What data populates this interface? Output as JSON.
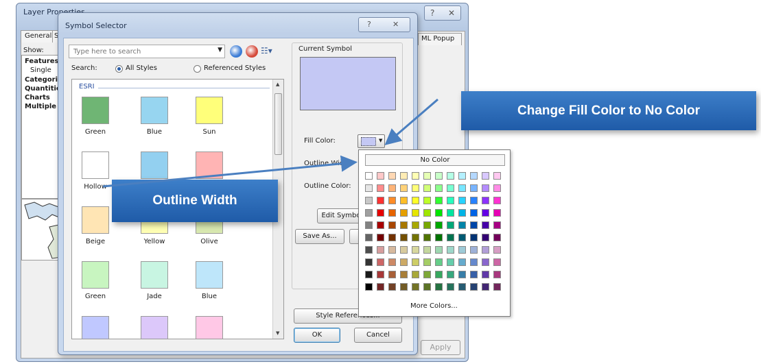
{
  "layer_properties": {
    "title": "Layer Properties",
    "tabs": [
      "General",
      "S"
    ],
    "right_tab": "ML Popup",
    "show_label": "Show:",
    "tree": [
      "Features",
      "Single",
      "Categori",
      "Quantitie",
      "Charts",
      "Multiple"
    ],
    "apply_label": "Apply"
  },
  "symbol_selector": {
    "title": "Symbol Selector",
    "search": {
      "placeholder": "Type here to search"
    },
    "search_label": "Search:",
    "radio_all": "All Styles",
    "radio_ref": "Referenced Styles",
    "group_label": "ESRI",
    "symbols": [
      {
        "label": "Green",
        "color": "#6fb574"
      },
      {
        "label": "Blue",
        "color": "#97d5f0"
      },
      {
        "label": "Sun",
        "color": "#ffff7a"
      },
      {
        "label": "Hollow",
        "color": "#ffffff"
      },
      {
        "label": "",
        "color": "#93d0f0"
      },
      {
        "label": "",
        "color": "#ffb4b4"
      },
      {
        "label": "Beige",
        "color": "#ffe5b4"
      },
      {
        "label": "Yellow",
        "color": "#ffffb4"
      },
      {
        "label": "Olive",
        "color": "#d8e8b0"
      },
      {
        "label": "Green",
        "color": "#c8f5c0"
      },
      {
        "label": "Jade",
        "color": "#c8f5e2"
      },
      {
        "label": "Blue",
        "color": "#bee6fa"
      },
      {
        "label": "",
        "color": "#c0c8ff"
      },
      {
        "label": "",
        "color": "#dcc8fa"
      },
      {
        "label": "",
        "color": "#ffc8e6"
      }
    ],
    "current_symbol_label": "Current Symbol",
    "current_fill": "#c4c8f4",
    "fill_color_label": "Fill Color:",
    "outline_width_label": "Outline Width:",
    "outline_color_label": "Outline Color:",
    "edit_symbol_label": "Edit Symbo",
    "save_as_label": "Save As...",
    "style_references_label": "Style References...",
    "ok_label": "OK",
    "cancel_label": "Cancel"
  },
  "palette": {
    "no_color_label": "No Color",
    "more_colors_label": "More Colors...",
    "columns": 12,
    "rows": [
      [
        "#ffffff",
        "#ffc8c8",
        "#ffd8b4",
        "#ffecb4",
        "#ffffb4",
        "#e6ffb4",
        "#c8ffc8",
        "#b4ffe6",
        "#b4f0ff",
        "#b4d8ff",
        "#d8c8ff",
        "#ffc8f0"
      ],
      [
        "#e6e6e6",
        "#ff8c8c",
        "#ffb478",
        "#ffd278",
        "#ffff78",
        "#d2ff78",
        "#8cff8c",
        "#78ffd2",
        "#78e6ff",
        "#78b4ff",
        "#b48cff",
        "#ff8ce6"
      ],
      [
        "#c8c8c8",
        "#ff3232",
        "#ff8c28",
        "#ffbe28",
        "#ffff28",
        "#beff28",
        "#32ff32",
        "#28ffbe",
        "#28d2ff",
        "#2882ff",
        "#8c32ff",
        "#ff32d2"
      ],
      [
        "#a0a0a0",
        "#e60000",
        "#e66400",
        "#e6a000",
        "#e6e600",
        "#a0e600",
        "#00e600",
        "#00e6a0",
        "#00b4e6",
        "#0064e6",
        "#6400e6",
        "#e600b4"
      ],
      [
        "#828282",
        "#a80000",
        "#a84600",
        "#a87800",
        "#a8a800",
        "#78a800",
        "#00a800",
        "#00a878",
        "#0084a8",
        "#0046a8",
        "#4600a8",
        "#a80084"
      ],
      [
        "#646464",
        "#730000",
        "#733200",
        "#735000",
        "#737300",
        "#507300",
        "#007300",
        "#007350",
        "#005a73",
        "#003273",
        "#320073",
        "#73005a"
      ],
      [
        "#4e4e4e",
        "#d79e9e",
        "#d7b99e",
        "#d7ca9e",
        "#d7d79e",
        "#c4d79e",
        "#9ed7b1",
        "#9ed7ca",
        "#9ecad7",
        "#9eb1d7",
        "#b19ed7",
        "#d79ec4"
      ],
      [
        "#343434",
        "#cd6666",
        "#cd8966",
        "#cdaa66",
        "#cdcd66",
        "#a5cd66",
        "#66cd89",
        "#66cdab",
        "#66abcd",
        "#6689cd",
        "#8966cd",
        "#cd66a5"
      ],
      [
        "#1a1a1a",
        "#a83838",
        "#a86038",
        "#a87e38",
        "#a8a838",
        "#7ea838",
        "#38a860",
        "#38a87e",
        "#387ea8",
        "#3860a8",
        "#6038a8",
        "#a8387e"
      ],
      [
        "#000000",
        "#732626",
        "#734226",
        "#735c26",
        "#737326",
        "#5c7326",
        "#267342",
        "#26735c",
        "#265c73",
        "#264273",
        "#422673",
        "#73265c"
      ]
    ]
  },
  "callouts": {
    "fill": "Change Fill Color to No Color",
    "outline": "Outline Width"
  }
}
